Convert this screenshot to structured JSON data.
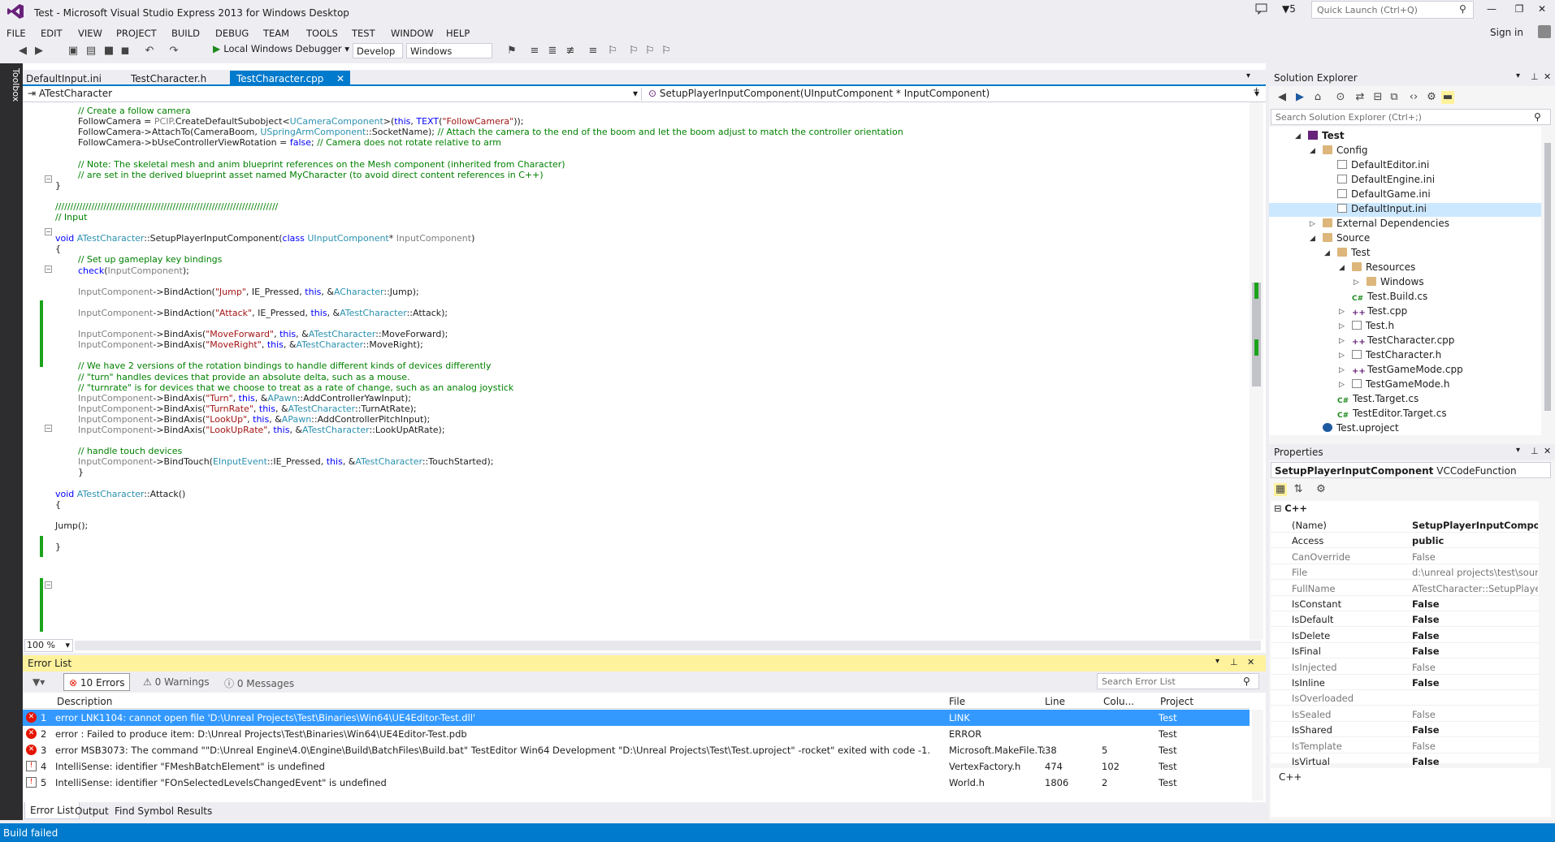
{
  "window": {
    "title": "Test - Microsoft Visual Studio Express 2013 for Windows Desktop",
    "notif_count": "5",
    "quick_launch_placeholder": "Quick Launch (Ctrl+Q)",
    "sign_in": "Sign in"
  },
  "menu": [
    "FILE",
    "EDIT",
    "VIEW",
    "PROJECT",
    "BUILD",
    "DEBUG",
    "TEAM",
    "TOOLS",
    "TEST",
    "WINDOW",
    "HELP"
  ],
  "toolbar": {
    "debugger": "Local Windows Debugger",
    "config": "Develop",
    "platform": "Windows"
  },
  "toolbox_label": "Toolbox",
  "editor": {
    "tabs": [
      "DefaultInput.ini",
      "TestCharacter.h",
      "TestCharacter.cpp"
    ],
    "nav_scope": "ATestCharacter",
    "nav_member": "SetupPlayerInputComponent(UInputComponent * InputComponent)",
    "zoom": "100 %"
  },
  "code": [
    [
      {
        "t": "// Create a follow camera",
        "c": "cm"
      }
    ],
    [
      {
        "t": "FollowCamera = "
      },
      {
        "t": "PCIP",
        "c": "gy"
      },
      {
        "t": ".CreateDefaultSubobject<"
      },
      {
        "t": "UCameraComponent",
        "c": "ty"
      },
      {
        "t": ">("
      },
      {
        "t": "this",
        "c": "kw"
      },
      {
        "t": ", "
      },
      {
        "t": "TEXT",
        "c": "kw"
      },
      {
        "t": "("
      },
      {
        "t": "\"FollowCamera\"",
        "c": "st"
      },
      {
        "t": "));"
      }
    ],
    [
      {
        "t": "FollowCamera->AttachTo(CameraBoom, "
      },
      {
        "t": "USpringArmComponent",
        "c": "ty"
      },
      {
        "t": "::SocketName); "
      },
      {
        "t": "// Attach the camera to the end of the boom and let the boom adjust to match the controller orientation",
        "c": "cm"
      }
    ],
    [
      {
        "t": "FollowCamera->bUseControllerViewRotation = "
      },
      {
        "t": "false",
        "c": "kw"
      },
      {
        "t": "; "
      },
      {
        "t": "// Camera does not rotate relative to arm",
        "c": "cm"
      }
    ],
    [
      {
        "t": ""
      }
    ],
    [
      {
        "t": "// Note: The skeletal mesh and anim blueprint references on the Mesh component (inherited from Character)",
        "c": "cm"
      }
    ],
    [
      {
        "t": "// are set in the derived blueprint asset named MyCharacter (to avoid direct content references in C++)",
        "c": "cm"
      }
    ],
    [
      {
        "t": "}"
      }
    ],
    [
      {
        "t": ""
      }
    ],
    [
      {
        "t": "//////////////////////////////////////////////////////////////////////////",
        "c": "cm"
      }
    ],
    [
      {
        "t": "// Input",
        "c": "cm"
      }
    ],
    [
      {
        "t": ""
      }
    ],
    [
      {
        "t": "void",
        "c": "kw"
      },
      {
        "t": " "
      },
      {
        "t": "ATestCharacter",
        "c": "ty"
      },
      {
        "t": "::SetupPlayerInputComponent("
      },
      {
        "t": "class",
        "c": "kw"
      },
      {
        "t": " "
      },
      {
        "t": "UInputComponent",
        "c": "ty"
      },
      {
        "t": "* "
      },
      {
        "t": "InputComponent",
        "c": "gy"
      },
      {
        "t": ")"
      }
    ],
    [
      {
        "t": "{"
      }
    ],
    [
      {
        "t": "// Set up gameplay key bindings",
        "c": "cm"
      }
    ],
    [
      {
        "t": "check",
        "c": "kw"
      },
      {
        "t": "("
      },
      {
        "t": "InputComponent",
        "c": "gy"
      },
      {
        "t": ");"
      }
    ],
    [
      {
        "t": ""
      }
    ],
    [
      {
        "t": "InputComponent",
        "c": "gy"
      },
      {
        "t": "->BindAction("
      },
      {
        "t": "\"Jump\"",
        "c": "st"
      },
      {
        "t": ", IE_Pressed, "
      },
      {
        "t": "this",
        "c": "kw"
      },
      {
        "t": ", &"
      },
      {
        "t": "ACharacter",
        "c": "ty"
      },
      {
        "t": "::Jump);"
      }
    ],
    [
      {
        "t": ""
      }
    ],
    [
      {
        "t": "InputComponent",
        "c": "gy"
      },
      {
        "t": "->BindAction("
      },
      {
        "t": "\"Attack\"",
        "c": "st"
      },
      {
        "t": ", IE_Pressed, "
      },
      {
        "t": "this",
        "c": "kw"
      },
      {
        "t": ", &"
      },
      {
        "t": "ATestCharacter",
        "c": "ty"
      },
      {
        "t": "::Attack);"
      }
    ],
    [
      {
        "t": ""
      }
    ],
    [
      {
        "t": "InputComponent",
        "c": "gy"
      },
      {
        "t": "->BindAxis("
      },
      {
        "t": "\"MoveForward\"",
        "c": "st"
      },
      {
        "t": ", "
      },
      {
        "t": "this",
        "c": "kw"
      },
      {
        "t": ", &"
      },
      {
        "t": "ATestCharacter",
        "c": "ty"
      },
      {
        "t": "::MoveForward);"
      }
    ],
    [
      {
        "t": "InputComponent",
        "c": "gy"
      },
      {
        "t": "->BindAxis("
      },
      {
        "t": "\"MoveRight\"",
        "c": "st"
      },
      {
        "t": ", "
      },
      {
        "t": "this",
        "c": "kw"
      },
      {
        "t": ", &"
      },
      {
        "t": "ATestCharacter",
        "c": "ty"
      },
      {
        "t": "::MoveRight);"
      }
    ],
    [
      {
        "t": ""
      }
    ],
    [
      {
        "t": "// We have 2 versions of the rotation bindings to handle different kinds of devices differently",
        "c": "cm"
      }
    ],
    [
      {
        "t": "// \"turn\" handles devices that provide an absolute delta, such as a mouse.",
        "c": "cm"
      }
    ],
    [
      {
        "t": "// \"turnrate\" is for devices that we choose to treat as a rate of change, such as an analog joystick",
        "c": "cm"
      }
    ],
    [
      {
        "t": "InputComponent",
        "c": "gy"
      },
      {
        "t": "->BindAxis("
      },
      {
        "t": "\"Turn\"",
        "c": "st"
      },
      {
        "t": ", "
      },
      {
        "t": "this",
        "c": "kw"
      },
      {
        "t": ", &"
      },
      {
        "t": "APawn",
        "c": "ty"
      },
      {
        "t": "::AddControllerYawInput);"
      }
    ],
    [
      {
        "t": "InputComponent",
        "c": "gy"
      },
      {
        "t": "->BindAxis("
      },
      {
        "t": "\"TurnRate\"",
        "c": "st"
      },
      {
        "t": ", "
      },
      {
        "t": "this",
        "c": "kw"
      },
      {
        "t": ", &"
      },
      {
        "t": "ATestCharacter",
        "c": "ty"
      },
      {
        "t": "::TurnAtRate);"
      }
    ],
    [
      {
        "t": "InputComponent",
        "c": "gy"
      },
      {
        "t": "->BindAxis("
      },
      {
        "t": "\"LookUp\"",
        "c": "st"
      },
      {
        "t": ", "
      },
      {
        "t": "this",
        "c": "kw"
      },
      {
        "t": ", &"
      },
      {
        "t": "APawn",
        "c": "ty"
      },
      {
        "t": "::AddControllerPitchInput);"
      }
    ],
    [
      {
        "t": "InputComponent",
        "c": "gy"
      },
      {
        "t": "->BindAxis("
      },
      {
        "t": "\"LookUpRate\"",
        "c": "st"
      },
      {
        "t": ", "
      },
      {
        "t": "this",
        "c": "kw"
      },
      {
        "t": ", &"
      },
      {
        "t": "ATestCharacter",
        "c": "ty"
      },
      {
        "t": "::LookUpAtRate);"
      }
    ],
    [
      {
        "t": ""
      }
    ],
    [
      {
        "t": "// handle touch devices",
        "c": "cm"
      }
    ],
    [
      {
        "t": "InputComponent",
        "c": "gy"
      },
      {
        "t": "->BindTouch("
      },
      {
        "t": "EInputEvent",
        "c": "ty"
      },
      {
        "t": "::IE_Pressed, "
      },
      {
        "t": "this",
        "c": "kw"
      },
      {
        "t": ", &"
      },
      {
        "t": "ATestCharacter",
        "c": "ty"
      },
      {
        "t": "::TouchStarted);"
      }
    ],
    [
      {
        "t": "}"
      }
    ],
    [
      {
        "t": ""
      }
    ],
    [
      {
        "t": "void",
        "c": "kw"
      },
      {
        "t": " "
      },
      {
        "t": "ATestCharacter",
        "c": "ty"
      },
      {
        "t": "::Attack()"
      }
    ],
    [
      {
        "t": "{"
      }
    ],
    [
      {
        "t": ""
      }
    ],
    [
      {
        "t": "Jump();"
      }
    ],
    [
      {
        "t": ""
      }
    ],
    [
      {
        "t": "}"
      }
    ]
  ],
  "error_list": {
    "title": "Error List",
    "errors_btn": "10 Errors",
    "warnings_btn": "0 Warnings",
    "messages_btn": "0 Messages",
    "search_placeholder": "Search Error List",
    "columns": [
      "Description",
      "File",
      "Line",
      "Colu...",
      "Project"
    ],
    "rows": [
      {
        "num": "1",
        "type": "error",
        "desc": "error LNK1104: cannot open file 'D:\\Unreal Projects\\Test\\Binaries\\Win64\\UE4Editor-Test.dll'",
        "file": "LINK",
        "line": "",
        "col": "",
        "project": "Test"
      },
      {
        "num": "2",
        "type": "error",
        "desc": "error : Failed to produce item: D:\\Unreal Projects\\Test\\Binaries\\Win64\\UE4Editor-Test.pdb",
        "file": "ERROR",
        "line": "",
        "col": "",
        "project": "Test"
      },
      {
        "num": "3",
        "type": "error",
        "desc": "error MSB3073: The command \"\"D:\\Unreal Engine\\4.0\\Engine\\Build\\BatchFiles\\Build.bat\" TestEditor Win64 Development \"D:\\Unreal Projects\\Test\\Test.uproject\" -rocket\" exited with code -1.",
        "file": "Microsoft.MakeFile.Ta",
        "line": "38",
        "col": "5",
        "project": "Test"
      },
      {
        "num": "4",
        "type": "intellisense",
        "desc": "IntelliSense: identifier \"FMeshBatchElement\" is undefined",
        "file": "VertexFactory.h",
        "line": "474",
        "col": "102",
        "project": "Test"
      },
      {
        "num": "5",
        "type": "intellisense",
        "desc": "IntelliSense: identifier \"FOnSelectedLevelsChangedEvent\" is undefined",
        "file": "World.h",
        "line": "1806",
        "col": "2",
        "project": "Test"
      }
    ]
  },
  "bottom_tabs": [
    "Error List",
    "Output",
    "Find Symbol Results"
  ],
  "status": "Build failed",
  "solution_explorer": {
    "title": "Solution Explorer",
    "search_placeholder": "Search Solution Explorer (Ctrl+;)",
    "tree": [
      {
        "label": "Test",
        "depth": 0,
        "icon": "solution",
        "arrow": "open",
        "bold": true
      },
      {
        "label": "Config",
        "depth": 1,
        "icon": "folder",
        "arrow": "open"
      },
      {
        "label": "DefaultEditor.ini",
        "depth": 2,
        "icon": "file"
      },
      {
        "label": "DefaultEngine.ini",
        "depth": 2,
        "icon": "file"
      },
      {
        "label": "DefaultGame.ini",
        "depth": 2,
        "icon": "file"
      },
      {
        "label": "DefaultInput.ini",
        "depth": 2,
        "icon": "file",
        "selected": true
      },
      {
        "label": "External Dependencies",
        "depth": 1,
        "icon": "folder",
        "arrow": "closed"
      },
      {
        "label": "Source",
        "depth": 1,
        "icon": "folder",
        "arrow": "open"
      },
      {
        "label": "Test",
        "depth": 2,
        "icon": "folder",
        "arrow": "open"
      },
      {
        "label": "Resources",
        "depth": 3,
        "icon": "folder",
        "arrow": "open"
      },
      {
        "label": "Windows",
        "depth": 4,
        "icon": "folder",
        "arrow": "closed"
      },
      {
        "label": "Test.Build.cs",
        "depth": 3,
        "icon": "cs"
      },
      {
        "label": "Test.cpp",
        "depth": 3,
        "icon": "cpp",
        "arrow": "closed"
      },
      {
        "label": "Test.h",
        "depth": 3,
        "icon": "file",
        "arrow": "closed"
      },
      {
        "label": "TestCharacter.cpp",
        "depth": 3,
        "icon": "cpp",
        "arrow": "closed"
      },
      {
        "label": "TestCharacter.h",
        "depth": 3,
        "icon": "file",
        "arrow": "closed"
      },
      {
        "label": "TestGameMode.cpp",
        "depth": 3,
        "icon": "cpp",
        "arrow": "closed"
      },
      {
        "label": "TestGameMode.h",
        "depth": 3,
        "icon": "file",
        "arrow": "closed"
      },
      {
        "label": "Test.Target.cs",
        "depth": 2,
        "icon": "cs"
      },
      {
        "label": "TestEditor.Target.cs",
        "depth": 2,
        "icon": "cs"
      },
      {
        "label": "Test.uproject",
        "depth": 1,
        "icon": "uproject"
      }
    ]
  },
  "properties": {
    "title": "Properties",
    "selected_name": "SetupPlayerInputComponent",
    "selected_type": "VCCodeFunction",
    "category": "C++",
    "rows": [
      {
        "name": "(Name)",
        "value": "SetupPlayerInputComponen",
        "dim": false,
        "bold": true
      },
      {
        "name": "Access",
        "value": "public",
        "dim": false,
        "bold": true
      },
      {
        "name": "CanOverride",
        "value": "False",
        "dim": true,
        "bold": false
      },
      {
        "name": "File",
        "value": "d:\\unreal projects\\test\\sourc",
        "dim": true,
        "bold": false
      },
      {
        "name": "FullName",
        "value": "ATestCharacter::SetupPlayer",
        "dim": true,
        "bold": false
      },
      {
        "name": "IsConstant",
        "value": "False",
        "dim": false,
        "bold": true
      },
      {
        "name": "IsDefault",
        "value": "False",
        "dim": false,
        "bold": true
      },
      {
        "name": "IsDelete",
        "value": "False",
        "dim": false,
        "bold": true
      },
      {
        "name": "IsFinal",
        "value": "False",
        "dim": false,
        "bold": true
      },
      {
        "name": "IsInjected",
        "value": "False",
        "dim": true,
        "bold": false
      },
      {
        "name": "IsInline",
        "value": "False",
        "dim": false,
        "bold": true
      },
      {
        "name": "IsOverloaded",
        "value": "",
        "dim": true,
        "bold": false
      },
      {
        "name": "IsSealed",
        "value": "False",
        "dim": true,
        "bold": false
      },
      {
        "name": "IsShared",
        "value": "False",
        "dim": false,
        "bold": true
      },
      {
        "name": "IsTemplate",
        "value": "False",
        "dim": true,
        "bold": false
      },
      {
        "name": "IsVirtual",
        "value": "False",
        "dim": false,
        "bold": true
      }
    ],
    "description": "C++"
  },
  "colors": {
    "accent": "#007acc",
    "error_title": "#fff29d",
    "selection": "#3399ff",
    "error_red": "#e51400"
  }
}
